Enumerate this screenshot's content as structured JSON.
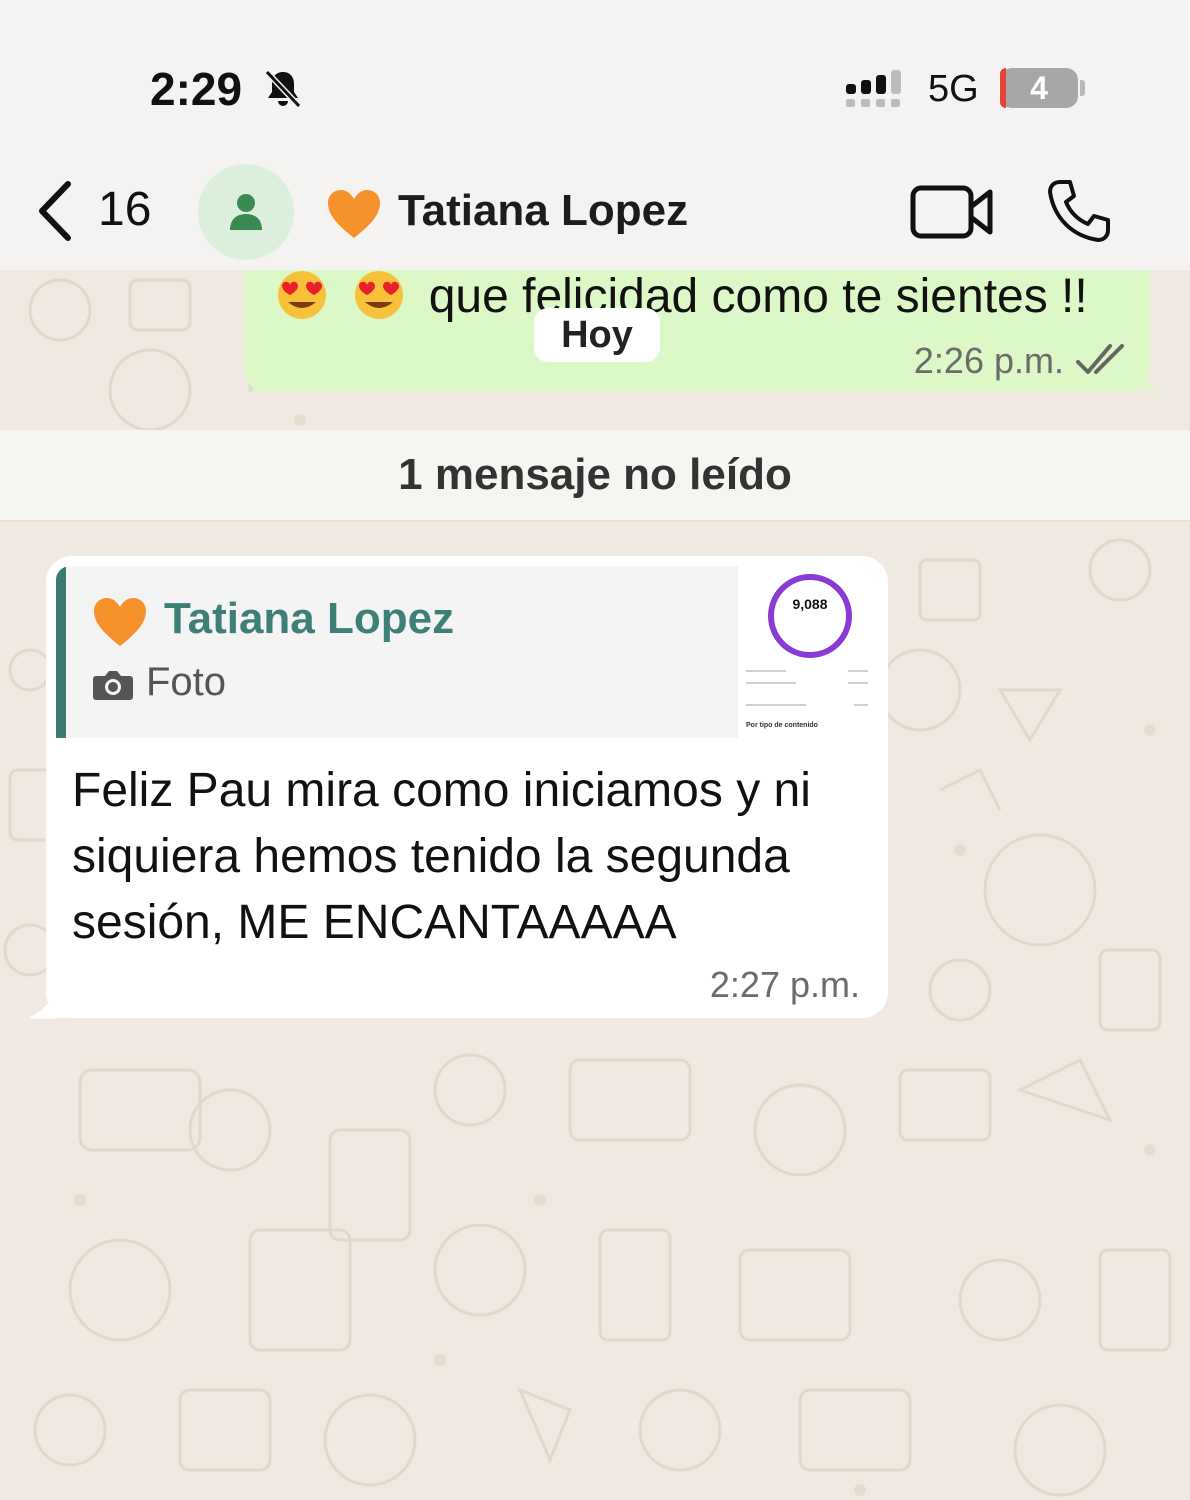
{
  "status_bar": {
    "time": "2:29",
    "network": "5G",
    "battery_level": "4"
  },
  "header": {
    "back_count": "16",
    "contact_name": "Tatiana Lopez"
  },
  "messages": {
    "outgoing": {
      "text": "que felicidad como te sientes !!",
      "time": "2:26 p.m."
    },
    "date_chip": "Hoy",
    "unread_banner": "1 mensaje no leído",
    "incoming": {
      "quote_name": "Tatiana Lopez",
      "quote_type": "Foto",
      "thumbnail_value": "9,088",
      "thumbnail_caption": "Por tipo de contenido",
      "text": "Feliz Pau mira como iniciamos y ni siquiera hemos tenido la segunda sesión, ME ENCANTAAAAA",
      "time": "2:27 p.m."
    }
  },
  "colors": {
    "outgoing_bubble": "#dcf8c6",
    "quote_accent": "#3c7b74",
    "wallpaper": "#efe9e1"
  },
  "icons": [
    "bell-slash-icon",
    "signal-icon",
    "back-chevron-icon",
    "contact-avatar-icon",
    "orange-heart-icon",
    "video-call-icon",
    "phone-icon",
    "read-ticks-icon",
    "camera-icon",
    "heart-eyes-emoji"
  ]
}
